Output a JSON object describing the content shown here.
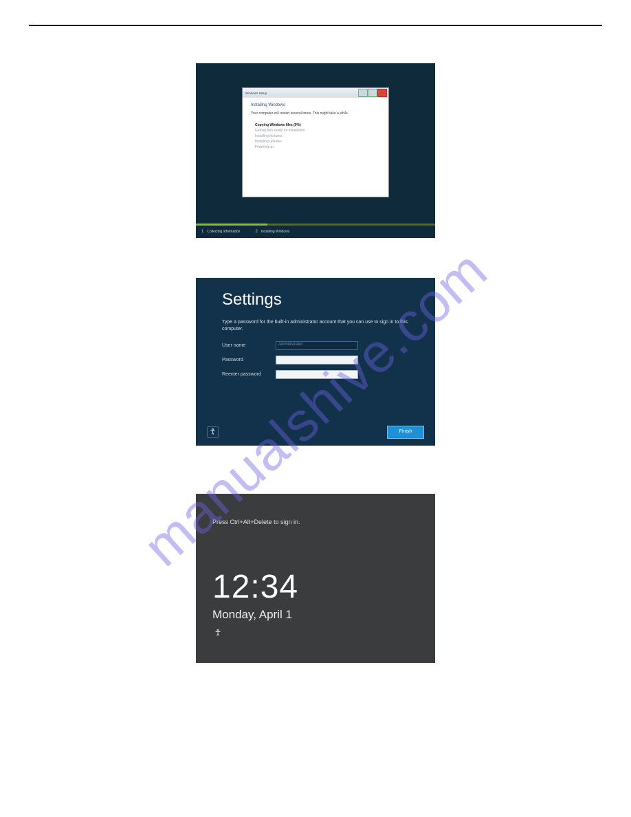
{
  "watermark": "manualshive.com",
  "screenshot1": {
    "window_title": "Windows Setup",
    "heading": "Installing Windows",
    "subtitle": "Your computer will restart several times. This might take a while.",
    "steps": {
      "copying": "Copying Windows files (0%)",
      "getting_ready": "Getting files ready for installation",
      "installing_features": "Installing features",
      "installing_updates": "Installing updates",
      "finishing": "Finishing up"
    },
    "footer_step1_num": "1",
    "footer_step1": "Collecting information",
    "footer_step2_num": "2",
    "footer_step2": "Installing Windows"
  },
  "screenshot2": {
    "title": "Settings",
    "desc": "Type a password for the built-in administrator account that you can use to sign in to this computer.",
    "username_label": "User name",
    "username_value": "Administrator",
    "password_label": "Password",
    "reenter_label": "Reenter password",
    "finish_label": "Finish"
  },
  "screenshot3": {
    "hint": "Press Ctrl+Alt+Delete to sign in.",
    "time": "12:34",
    "date": "Monday, April 1"
  }
}
